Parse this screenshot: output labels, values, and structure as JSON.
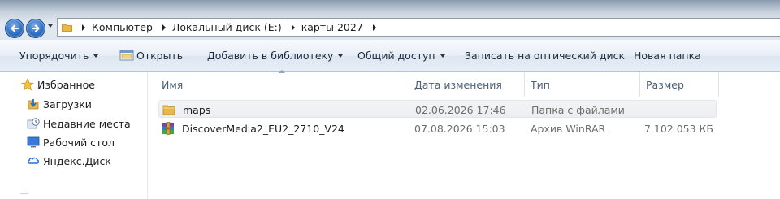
{
  "address": {
    "crumbs": [
      "Компьютер",
      "Локальный диск (E:)",
      "карты 2027"
    ]
  },
  "toolbar": {
    "organize": "Упорядочить",
    "open": "Открыть",
    "add_to_library": "Добавить в библиотеку",
    "share": "Общий доступ",
    "burn": "Записать на оптический диск",
    "new_folder": "Новая папка"
  },
  "sidebar": {
    "items": [
      {
        "label": "Избранное",
        "icon": "star-icon"
      },
      {
        "label": "Загрузки",
        "icon": "downloads-icon"
      },
      {
        "label": "Недавние места",
        "icon": "recent-places-icon"
      },
      {
        "label": "Рабочий стол",
        "icon": "desktop-icon"
      },
      {
        "label": "Яндекс.Диск",
        "icon": "yandex-disk-icon"
      }
    ]
  },
  "columns": {
    "name": "Имя",
    "date": "Дата изменения",
    "type": "Тип",
    "size": "Размер"
  },
  "files": [
    {
      "name": "maps",
      "date": "02.06.2026 17:46",
      "type": "Папка с файлами",
      "size": "",
      "icon": "folder-icon"
    },
    {
      "name": "DiscoverMedia2_EU2_2710_V24",
      "date": "07.08.2026 15:03",
      "type": "Архив WinRAR",
      "size": "7 102 053 КБ",
      "icon": "winrar-archive-icon"
    }
  ],
  "colors": {
    "nav_button": "#2e6fc2",
    "folder": "#e8b84a",
    "header_text": "#4c607a",
    "row_highlight": "#eceef1"
  }
}
